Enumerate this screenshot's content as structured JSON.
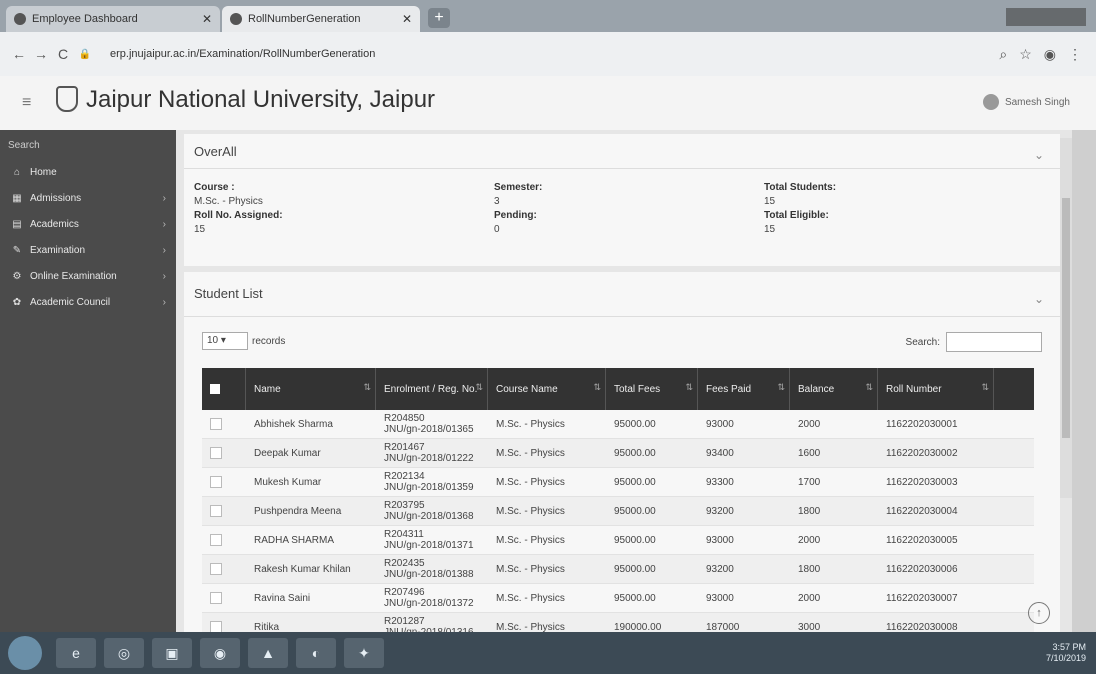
{
  "browser": {
    "tabs": [
      {
        "title": "Employee Dashboard"
      },
      {
        "title": "RollNumberGeneration"
      }
    ],
    "url": "erp.jnujaipur.ac.in/Examination/RollNumberGeneration"
  },
  "header": {
    "title": "Jaipur National University, Jaipur",
    "user_name": "Samesh Singh"
  },
  "sidebar": {
    "search_label": "Search",
    "items": [
      {
        "label": "Home",
        "icon": "home-icon"
      },
      {
        "label": "Admissions",
        "icon": "admissions-icon"
      },
      {
        "label": "Academics",
        "icon": "academics-icon"
      },
      {
        "label": "Examination",
        "icon": "examination-icon"
      },
      {
        "label": "Online Examination",
        "icon": "online-examination-icon"
      },
      {
        "label": "Academic Council",
        "icon": "council-icon"
      }
    ]
  },
  "overall": {
    "title": "OverAll",
    "course_label": "Course :",
    "course_value": "M.Sc. - Physics",
    "rollno_label": "Roll No. Assigned:",
    "rollno_value": "15",
    "semester_label": "Semester:",
    "semester_value": "3",
    "pending_label": "Pending:",
    "pending_value": "0",
    "total_students_label": "Total Students:",
    "total_students_value": "15",
    "total_eligible_label": "Total Eligible:",
    "total_eligible_value": "15"
  },
  "student_list": {
    "title": "Student List",
    "length_value": "10",
    "length_label": "records",
    "search_label": "Search:",
    "columns": [
      "Name",
      "Enrolment / Reg. No.",
      "Course Name",
      "Total Fees",
      "Fees Paid",
      "Balance",
      "Roll Number"
    ],
    "rows": [
      {
        "name": "Abhishek Sharma",
        "reg1": "R204850",
        "reg2": "JNU/gn-2018/01365",
        "course": "M.Sc. - Physics",
        "total": "95000.00",
        "paid": "93000",
        "balance": "2000",
        "roll": "1162202030001"
      },
      {
        "name": "Deepak Kumar",
        "reg1": "R201467",
        "reg2": "JNU/gn-2018/01222",
        "course": "M.Sc. - Physics",
        "total": "95000.00",
        "paid": "93400",
        "balance": "1600",
        "roll": "1162202030002"
      },
      {
        "name": "Mukesh Kumar",
        "reg1": "R202134",
        "reg2": "JNU/gn-2018/01359",
        "course": "M.Sc. - Physics",
        "total": "95000.00",
        "paid": "93300",
        "balance": "1700",
        "roll": "1162202030003"
      },
      {
        "name": "Pushpendra Meena",
        "reg1": "R203795",
        "reg2": "JNU/gn-2018/01368",
        "course": "M.Sc. - Physics",
        "total": "95000.00",
        "paid": "93200",
        "balance": "1800",
        "roll": "1162202030004"
      },
      {
        "name": "RADHA SHARMA",
        "reg1": "R204311",
        "reg2": "JNU/gn-2018/01371",
        "course": "M.Sc. - Physics",
        "total": "95000.00",
        "paid": "93000",
        "balance": "2000",
        "roll": "1162202030005"
      },
      {
        "name": "Rakesh Kumar Khilan",
        "reg1": "R202435",
        "reg2": "JNU/gn-2018/01388",
        "course": "M.Sc. - Physics",
        "total": "95000.00",
        "paid": "93200",
        "balance": "1800",
        "roll": "1162202030006"
      },
      {
        "name": "Ravina Saini",
        "reg1": "R207496",
        "reg2": "JNU/gn-2018/01372",
        "course": "M.Sc. - Physics",
        "total": "95000.00",
        "paid": "93000",
        "balance": "2000",
        "roll": "1162202030007"
      },
      {
        "name": "Ritika",
        "reg1": "R201287",
        "reg2": "JNU/gn-2018/01316",
        "course": "M.Sc. - Physics",
        "total": "190000.00",
        "paid": "187000",
        "balance": "3000",
        "roll": "1162202030008"
      }
    ]
  },
  "taskbar": {
    "time": "3:57 PM",
    "date": "7/10/2019"
  }
}
